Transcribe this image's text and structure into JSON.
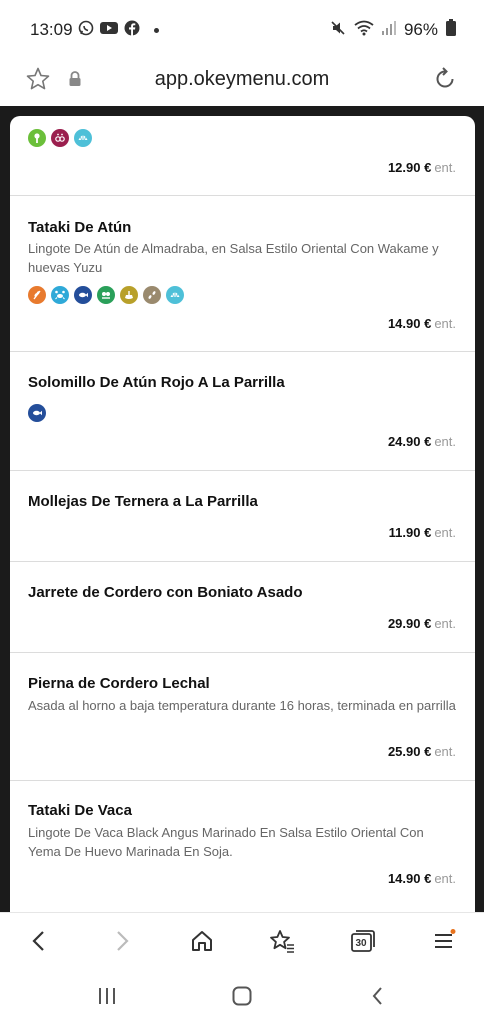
{
  "status": {
    "time": "13:09",
    "battery": "96%",
    "notification_icons": [
      "whatsapp-icon",
      "youtube-icon",
      "facebook-icon"
    ],
    "system_icons": [
      "mute-icon",
      "wifi-icon",
      "signal-icon",
      "battery-icon"
    ]
  },
  "browser": {
    "url": "app.okeymenu.com"
  },
  "menu": {
    "items": [
      {
        "name": "",
        "description": "",
        "allergens": [
          "celery",
          "mustard",
          "molluscs"
        ],
        "price": "12.90 €",
        "unit": "ent."
      },
      {
        "name": "Tataki De Atún",
        "description": "Lingote De Atún de Almadraba, en Salsa Estilo Oriental Con Wakame y huevas Yuzu",
        "allergens": [
          "gluten",
          "crustaceans",
          "fish",
          "soy",
          "mustard",
          "sesame",
          "molluscs"
        ],
        "price": "14.90 €",
        "unit": "ent."
      },
      {
        "name": "Solomillo De Atún Rojo A La Parrilla",
        "description": "",
        "allergens": [
          "fish"
        ],
        "price": "24.90 €",
        "unit": "ent."
      },
      {
        "name": "Mollejas De Ternera a La Parrilla",
        "description": "",
        "allergens": [],
        "price": "11.90 €",
        "unit": "ent."
      },
      {
        "name": "Jarrete de Cordero con Boniato Asado",
        "description": "",
        "allergens": [],
        "price": "29.90 €",
        "unit": "ent."
      },
      {
        "name": "Pierna de Cordero Lechal",
        "description": "Asada al horno a baja temperatura durante 16 horas, terminada en parrilla",
        "allergens": [],
        "price": "25.90 €",
        "unit": "ent."
      },
      {
        "name": "Tataki De Vaca",
        "description": "Lingote De Vaca Black Angus Marinado En Salsa Estilo Oriental Con Yema De Huevo Marinada En Soja.",
        "allergens": [],
        "price": "14.90 €",
        "unit": "ent."
      }
    ]
  },
  "allergen_colors": {
    "celery": "#6bbf3a",
    "mustard": "#9b1f4e",
    "molluscs": "#4ec0d8",
    "gluten": "#e87a2e",
    "crustaceans": "#2fa9d8",
    "fish": "#244e9a",
    "soy": "#2aa05a",
    "sesame": "#b8a02a",
    "nuts": "#9a8a6e"
  },
  "toolbar": {
    "tab_count": "30"
  }
}
